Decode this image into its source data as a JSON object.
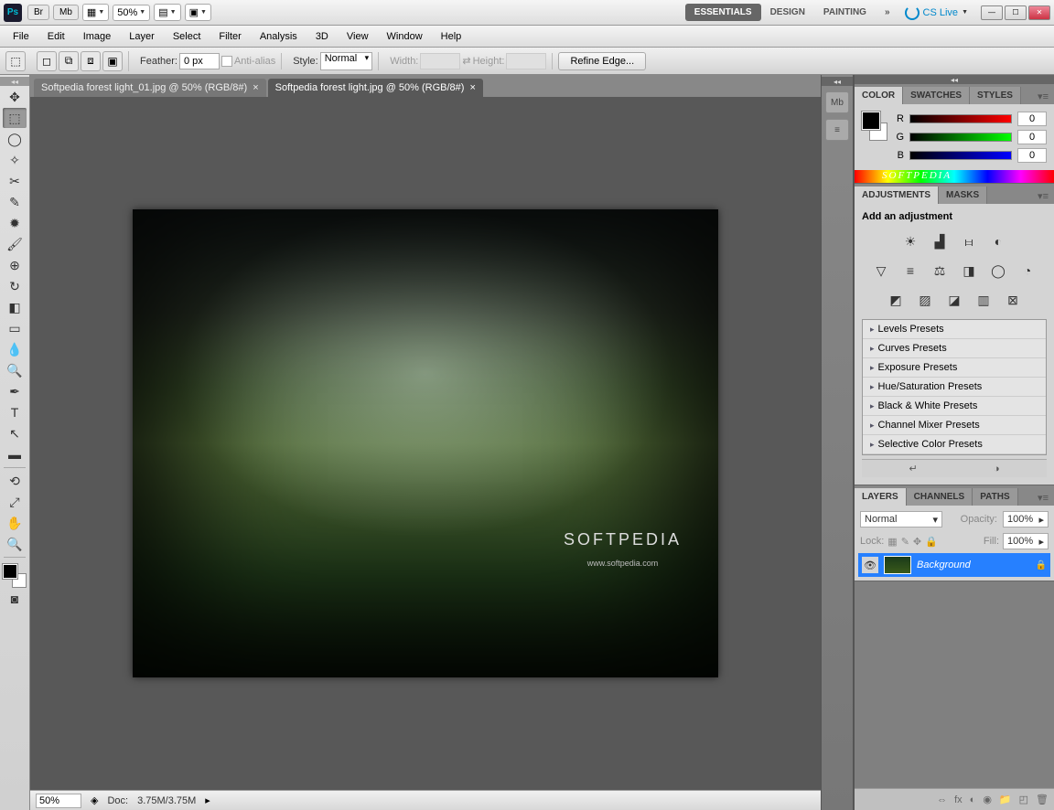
{
  "titlebar": {
    "zoom": "50%",
    "workspaces": [
      "ESSENTIALS",
      "DESIGN",
      "PAINTING"
    ],
    "cslive": "CS Live"
  },
  "menus": [
    "File",
    "Edit",
    "Image",
    "Layer",
    "Select",
    "Filter",
    "Analysis",
    "3D",
    "View",
    "Window",
    "Help"
  ],
  "options": {
    "feather_label": "Feather:",
    "feather_value": "0 px",
    "antialias": "Anti-alias",
    "style_label": "Style:",
    "style_value": "Normal",
    "width_label": "Width:",
    "height_label": "Height:",
    "refine": "Refine Edge..."
  },
  "tabs": [
    {
      "title": "Softpedia forest light_01.jpg @ 50% (RGB/8#)",
      "active": false
    },
    {
      "title": "Softpedia forest light.jpg @ 50% (RGB/8#)",
      "active": true
    }
  ],
  "watermark": {
    "title": "SOFTPEDIA",
    "url": "www.softpedia.com"
  },
  "status": {
    "zoom": "50%",
    "doc_label": "Doc:",
    "doc_value": "3.75M/3.75M"
  },
  "color_panel": {
    "tabs": [
      "COLOR",
      "SWATCHES",
      "STYLES"
    ],
    "r": "0",
    "g": "0",
    "b": "0",
    "hue_watermark": "SOFTPEDIA"
  },
  "adjustments": {
    "tabs": [
      "ADJUSTMENTS",
      "MASKS"
    ],
    "title": "Add an adjustment",
    "presets": [
      "Levels Presets",
      "Curves Presets",
      "Exposure Presets",
      "Hue/Saturation Presets",
      "Black & White Presets",
      "Channel Mixer Presets",
      "Selective Color Presets"
    ]
  },
  "layers": {
    "tabs": [
      "LAYERS",
      "CHANNELS",
      "PATHS"
    ],
    "blend": "Normal",
    "opacity_label": "Opacity:",
    "opacity": "100%",
    "lock_label": "Lock:",
    "fill_label": "Fill:",
    "fill": "100%",
    "items": [
      {
        "name": "Background"
      }
    ]
  }
}
